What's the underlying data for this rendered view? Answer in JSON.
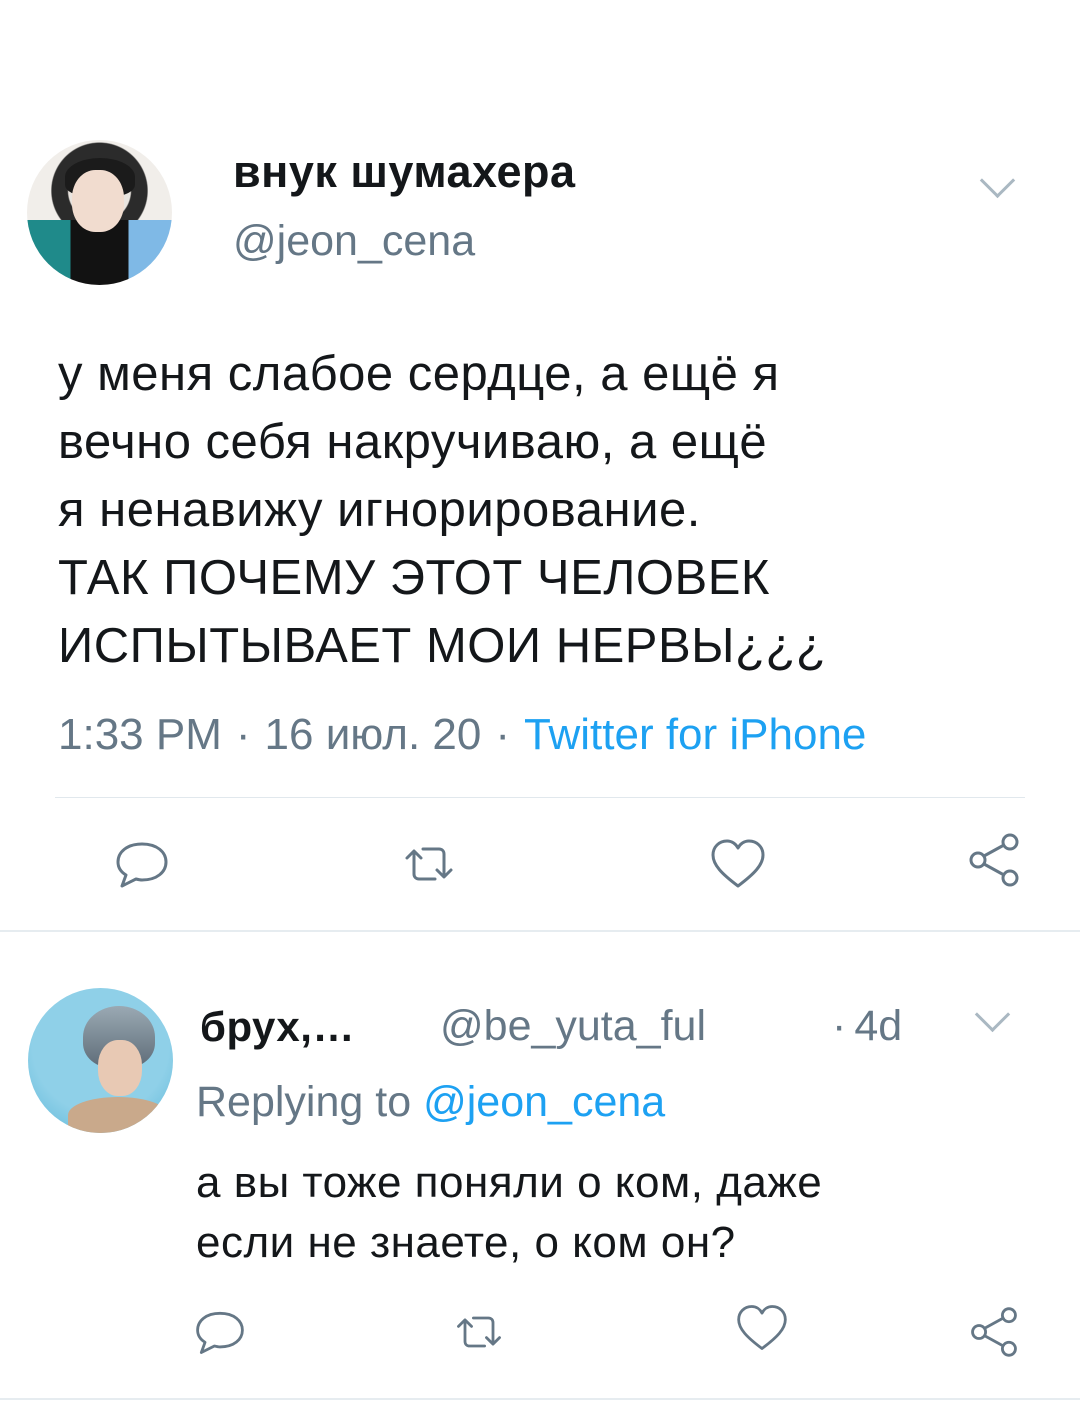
{
  "main_tweet": {
    "author_name": "внук шумахера",
    "author_handle": "@jeon_cena",
    "text": "у меня слабое сердце, а ещё я\nвечно себя накручиваю, а ещё\nя ненавижу игнорирование.\nТАК ПОЧЕМУ ЭТОТ ЧЕЛОВЕК\nИСПЫТЫВАЕТ МОИ НЕРВЫ¿¿¿",
    "time": "1:33 PM",
    "separator": "·",
    "date": "16 июл. 20",
    "source": "Twitter for iPhone"
  },
  "reply_tweet": {
    "author_name": "брух,…",
    "author_handle": "@be_yuta_ful",
    "time": "4d",
    "time_separator": "·",
    "replying_label": "Replying to",
    "replying_mention": "@jeon_cena",
    "text": "а вы тоже поняли о ком, даже\nесли не знаете, о ком он?"
  },
  "icons": {
    "reply": "reply-bubble-icon",
    "retweet": "retweet-icon",
    "like": "heart-icon",
    "share": "share-icon",
    "more": "chevron-down-icon"
  },
  "colors": {
    "text": "#14171a",
    "secondary": "#657786",
    "link": "#1da1f2",
    "icon": "#657786",
    "divider": "#e1e8ed"
  }
}
